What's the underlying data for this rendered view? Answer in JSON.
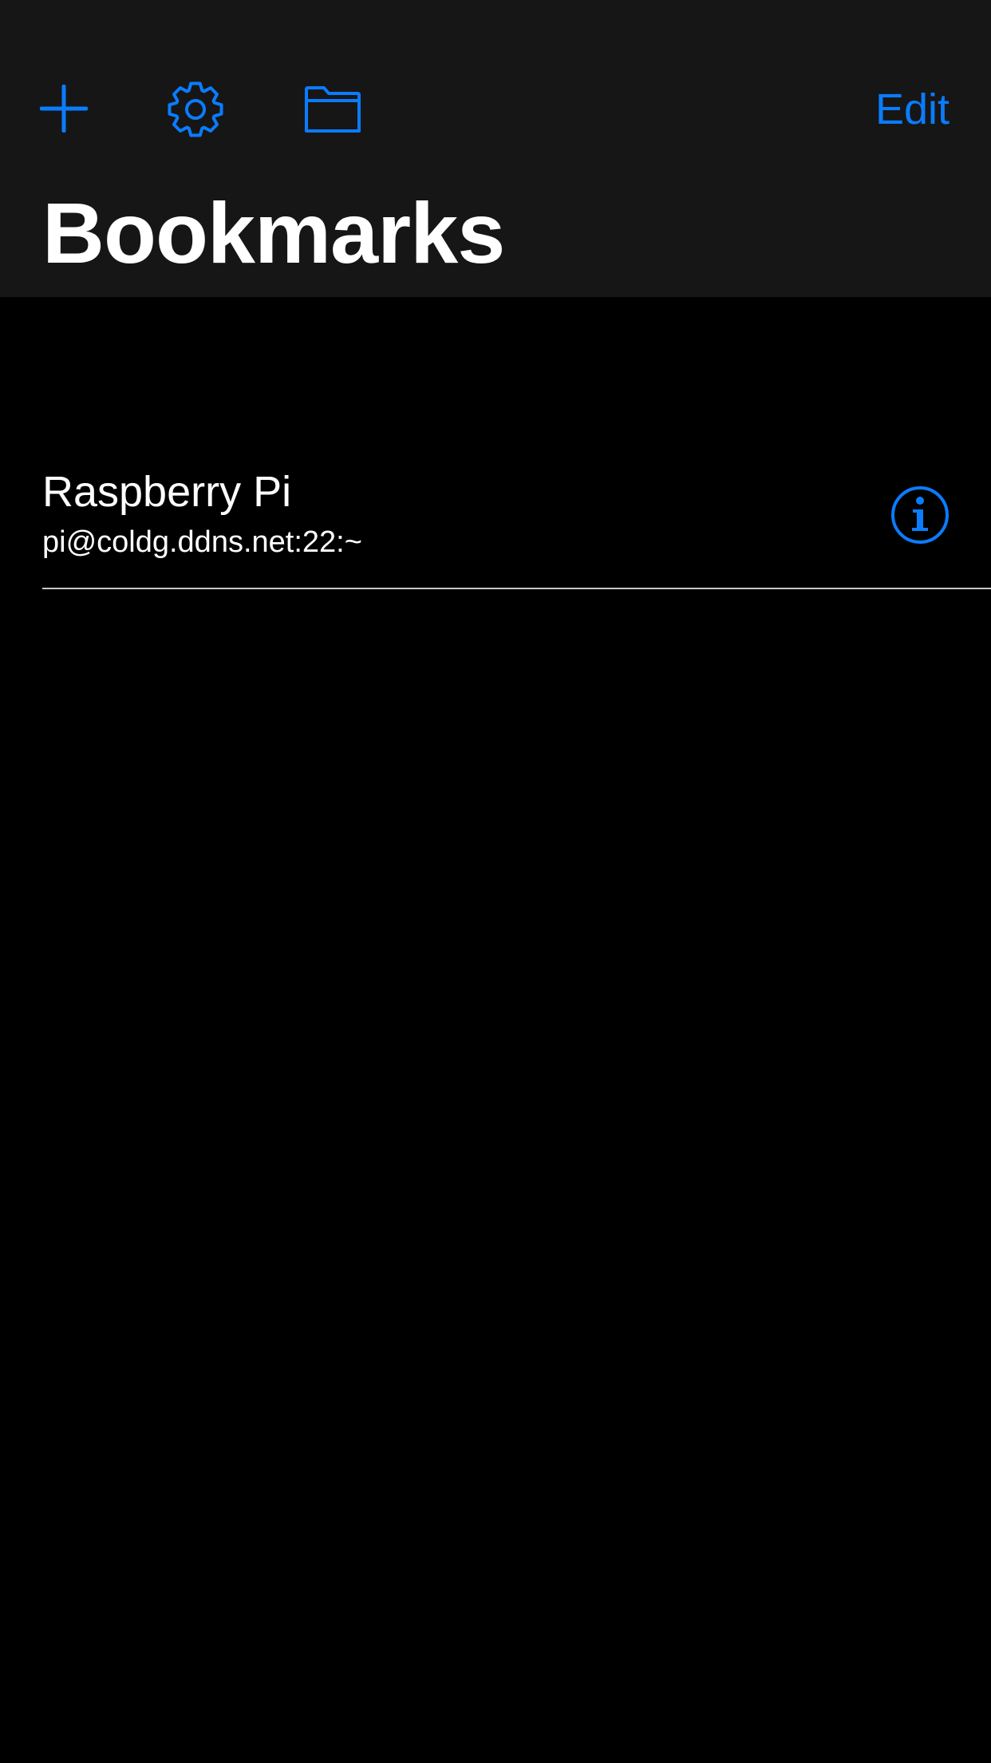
{
  "nav": {
    "edit_label": "Edit",
    "title": "Bookmarks",
    "icons": {
      "add": "plus-icon",
      "settings": "gear-icon",
      "folders": "folder-icon",
      "info": "info-icon"
    }
  },
  "bookmarks": [
    {
      "name": "Raspberry Pi",
      "address": "pi@coldg.ddns.net:22:~"
    }
  ],
  "colors": {
    "accent": "#0a7cff",
    "nav_background": "#161616",
    "background": "#000000",
    "text": "#ffffff"
  }
}
